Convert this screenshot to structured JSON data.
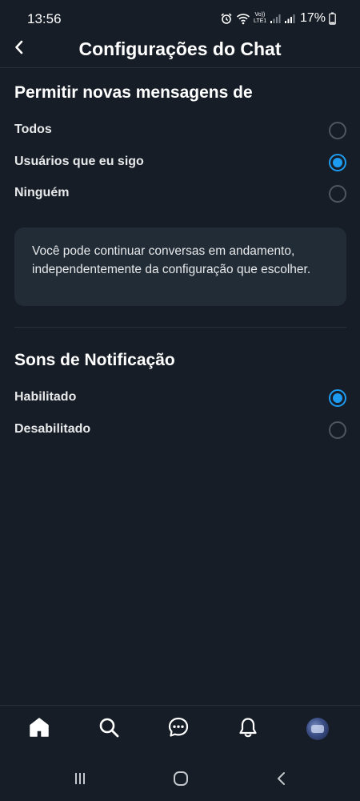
{
  "status_bar": {
    "time": "13:56",
    "volte_line1": "Vo))",
    "volte_line2": "LTE1",
    "battery": "17%"
  },
  "header": {
    "title": "Configurações do Chat",
    "back_icon": "chevron-left-icon"
  },
  "messages_section": {
    "title": "Permitir novas mensagens de",
    "options": [
      {
        "label": "Todos",
        "selected": false
      },
      {
        "label": "Usuários que eu sigo",
        "selected": true
      },
      {
        "label": "Ninguém",
        "selected": false
      }
    ],
    "info": "Você pode continuar conversas em andamento, independentemente da configuração que escolher."
  },
  "sounds_section": {
    "title": "Sons de Notificação",
    "options": [
      {
        "label": "Habilitado",
        "selected": true
      },
      {
        "label": "Desabilitado",
        "selected": false
      }
    ]
  },
  "bottom_nav": {
    "items": [
      "home-icon",
      "search-icon",
      "chat-icon",
      "bell-icon",
      "avatar"
    ]
  },
  "system_nav": {
    "items": [
      "recents-icon",
      "home-circle-icon",
      "back-icon"
    ]
  },
  "colors": {
    "background": "#161d26",
    "accent": "#1d9bf0",
    "card": "#222c37",
    "divider": "#28313b"
  }
}
